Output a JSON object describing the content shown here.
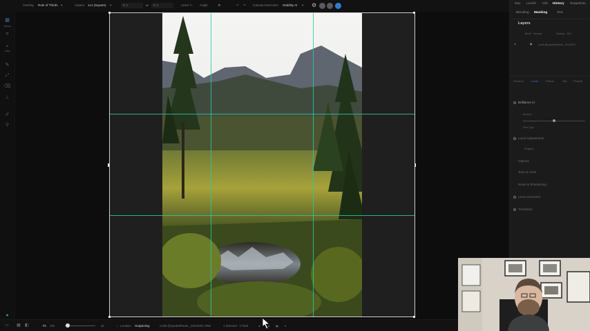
{
  "toolbar": {
    "overlay_label": "Overlay",
    "overlay_value": "Rule of Thirds",
    "aspect_label": "Aspect",
    "aspect_value": "1x1 (Square)",
    "width_value": "H 1",
    "height_value": "H 1",
    "level_label": "Level",
    "angle_label": "Angle",
    "angle_value": "0",
    "canvas_extension_label": "Canvas Extension",
    "canvas_extension_value": "Stability AI",
    "accent_color": "#2a7fd4"
  },
  "leftbar": {
    "tools": [
      {
        "icon": "grid-icon",
        "label": "Browse"
      },
      {
        "icon": "crop-icon",
        "label": ""
      },
      {
        "icon": "mask-icon",
        "label": "Mask"
      },
      {
        "icon": "brush-icon",
        "label": ""
      },
      {
        "icon": "select-icon",
        "label": ""
      },
      {
        "icon": "eraser-icon",
        "label": ""
      },
      {
        "icon": "stamp-icon",
        "label": ""
      },
      {
        "icon": "eyedropper-icon",
        "label": ""
      },
      {
        "icon": "search-icon",
        "label": ""
      }
    ]
  },
  "canvas": {
    "grid_color": "#2fc7a8",
    "overlay": "rule-of-thirds"
  },
  "bottombar": {
    "fit_label": "Fit",
    "zoom_value": "100",
    "slider_end": "32",
    "location_label": "Location",
    "location_value": "Outpainting",
    "credit_text": "credit @ryanbeiltheule _DSC0037.ARW",
    "selection_text": "1 Selected · 4 Total"
  },
  "rpanel": {
    "top_tabs": [
      "Nav",
      "Levels",
      "Info",
      "History",
      "Snapshots"
    ],
    "active_top_tab": "History",
    "sub_tabs": [
      "Blending",
      "Masking",
      "Text"
    ],
    "active_sub_tab": "Masking",
    "layers_title": "Layers",
    "blend_label": "Blend · Normal",
    "opacity_label": "Opacity · 100",
    "layer_name": "credit @ryanbeiltheule _DSC0037",
    "edit_tabs": [
      "Develop",
      "Local",
      "Effects",
      "Sky",
      "Portrait"
    ],
    "brilliance_title": "Brilliance AI",
    "amount_label": "Amount",
    "focus_label": "Fine Type",
    "local_adjustments_label": "Local Adjustments",
    "regions_label": "Regions",
    "options_label": "Options",
    "sections": [
      "Tone & Color",
      "Noise & Sharpening",
      "Lens Correction",
      "Transform"
    ]
  }
}
